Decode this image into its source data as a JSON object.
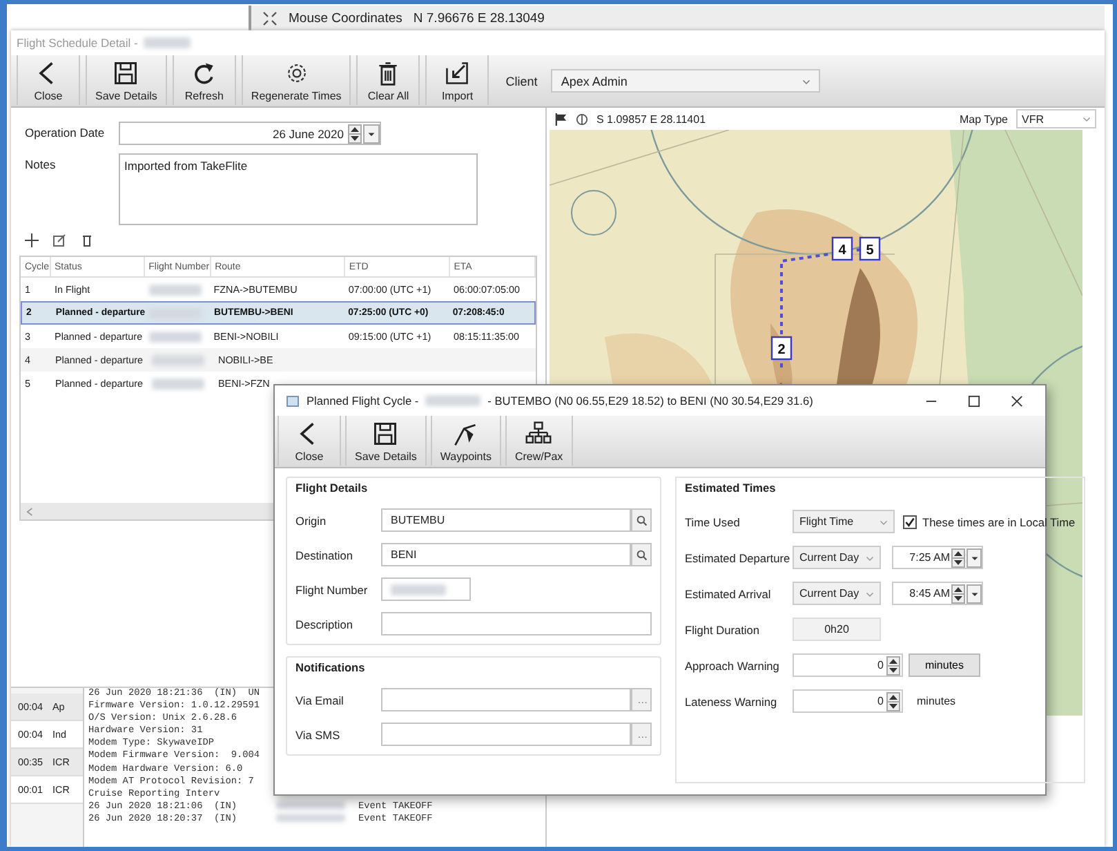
{
  "background": {
    "mouse_label": "Mouse Coordinates",
    "mouse_coordinates": "N 7.96676 E 28.13049"
  },
  "main_window": {
    "title": "Flight Schedule Detail -",
    "toolbar": [
      {
        "label": "Close"
      },
      {
        "label": "Save Details"
      },
      {
        "label": "Refresh"
      },
      {
        "label": "Regenerate Times"
      },
      {
        "label": "Clear All"
      },
      {
        "label": "Import"
      }
    ],
    "client_label": "Client",
    "client": "Apex Admin"
  },
  "schedule": {
    "operation_date_label": "Operation Date",
    "operation_date": "26 June 2020",
    "notes_label": "Notes",
    "notes": "Imported from TakeFlite",
    "columns": [
      "Cycle",
      "Status",
      "Flight Number",
      "Route",
      "ETD",
      "ETA"
    ],
    "rows": [
      {
        "cycle": "1",
        "status": "In Flight",
        "route": "FZNA->BUTEMBU",
        "etd": "07:00:00 (UTC +1)",
        "eta": "06:00:07:05:00",
        "selected": false
      },
      {
        "cycle": "2",
        "status": "Planned - departure",
        "route": "BUTEMBU->BENI",
        "etd": "07:25:00 (UTC +0)",
        "eta": "07:208:45:0",
        "selected": true
      },
      {
        "cycle": "3",
        "status": "Planned - departure",
        "route": "BENI->NOBILI",
        "etd": "09:15:00 (UTC +1)",
        "eta": "08:15:11:35:00",
        "selected": false
      },
      {
        "cycle": "4",
        "status": "Planned - departure",
        "route": "NOBILI->BE",
        "selected": false
      },
      {
        "cycle": "5",
        "status": "Planned - departure",
        "route": "BENI->FZN",
        "selected": false
      }
    ]
  },
  "map": {
    "coordinates": "S 1.09857 E 28.11401",
    "map_type_label": "Map Type",
    "map_type": "VFR",
    "markers": [
      {
        "label": "2"
      },
      {
        "label": "4"
      },
      {
        "label": "5"
      }
    ]
  },
  "log": {
    "entries": [
      {
        "time": "00:04",
        "type": "Ap"
      },
      {
        "time": "00:04",
        "type": "Ind"
      },
      {
        "time": "00:35",
        "type": "ICR"
      },
      {
        "time": "00:01",
        "type": "ICR"
      }
    ],
    "lines": [
      "26 Jun 2020 18:21:36  (IN)  UN",
      "Firmware Version: 1.0.12.29591",
      "O/S Version: Unix 2.6.28.6",
      "Hardware Version: 31",
      "Modem Type: SkywaveIDP",
      "Modem Firmware Version:  9.004",
      "Modem Hardware Version: 6.0",
      "Modem AT Protocol Revision: 7",
      "Cruise Reporting Interv"
    ],
    "events": [
      {
        "time": "26 Jun 2020 18:21:06  (IN)",
        "event": "Event TAKEOFF"
      },
      {
        "time": "26 Jun 2020 18:20:37  (IN)",
        "event": "Event TAKEOFF"
      }
    ]
  },
  "dialog": {
    "title_prefix": "Planned Flight Cycle -",
    "title_suffix": "- BUTEMBO (N0 06.55,E29 18.52) to BENI (N0 30.54,E29 31.6)",
    "toolbar": [
      {
        "label": "Close"
      },
      {
        "label": "Save Details"
      },
      {
        "label": "Waypoints"
      },
      {
        "label": "Crew/Pax"
      }
    ],
    "groups": [
      {
        "title": "Flight Details",
        "fields": [
          {
            "label": "Origin",
            "kind": "search",
            "value": "BUTEMBU"
          },
          {
            "label": "Destination",
            "kind": "search",
            "value": "BENI"
          },
          {
            "label": "Flight Number",
            "kind": "masked"
          },
          {
            "label": "Description",
            "kind": "plain"
          }
        ]
      },
      {
        "title": "Notifications",
        "fields": [
          {
            "label": "Via Email",
            "kind": "ellipsis"
          },
          {
            "label": "Via SMS",
            "kind": "ellipsis"
          }
        ]
      }
    ],
    "times": {
      "title": "Estimated Times",
      "rows": [
        {
          "label": "Time Used",
          "kind": "select_check",
          "value": "Flight Time",
          "checkbox_label": "These times are in Local Time",
          "checked": true
        },
        {
          "label": "Estimated Departure",
          "kind": "day_time",
          "value": "Current Day",
          "time": "7:25 AM"
        },
        {
          "label": "Estimated Arrival",
          "kind": "day_time",
          "value": "Current Day",
          "time": "8:45 AM"
        },
        {
          "label": "Flight Duration",
          "kind": "readonly",
          "value": "0h20"
        },
        {
          "label": "Approach Warning",
          "kind": "spin_button",
          "value": "0",
          "unit": "minutes"
        },
        {
          "label": "Lateness Warning",
          "kind": "spin_text",
          "value": "0",
          "unit": "minutes"
        }
      ]
    }
  }
}
